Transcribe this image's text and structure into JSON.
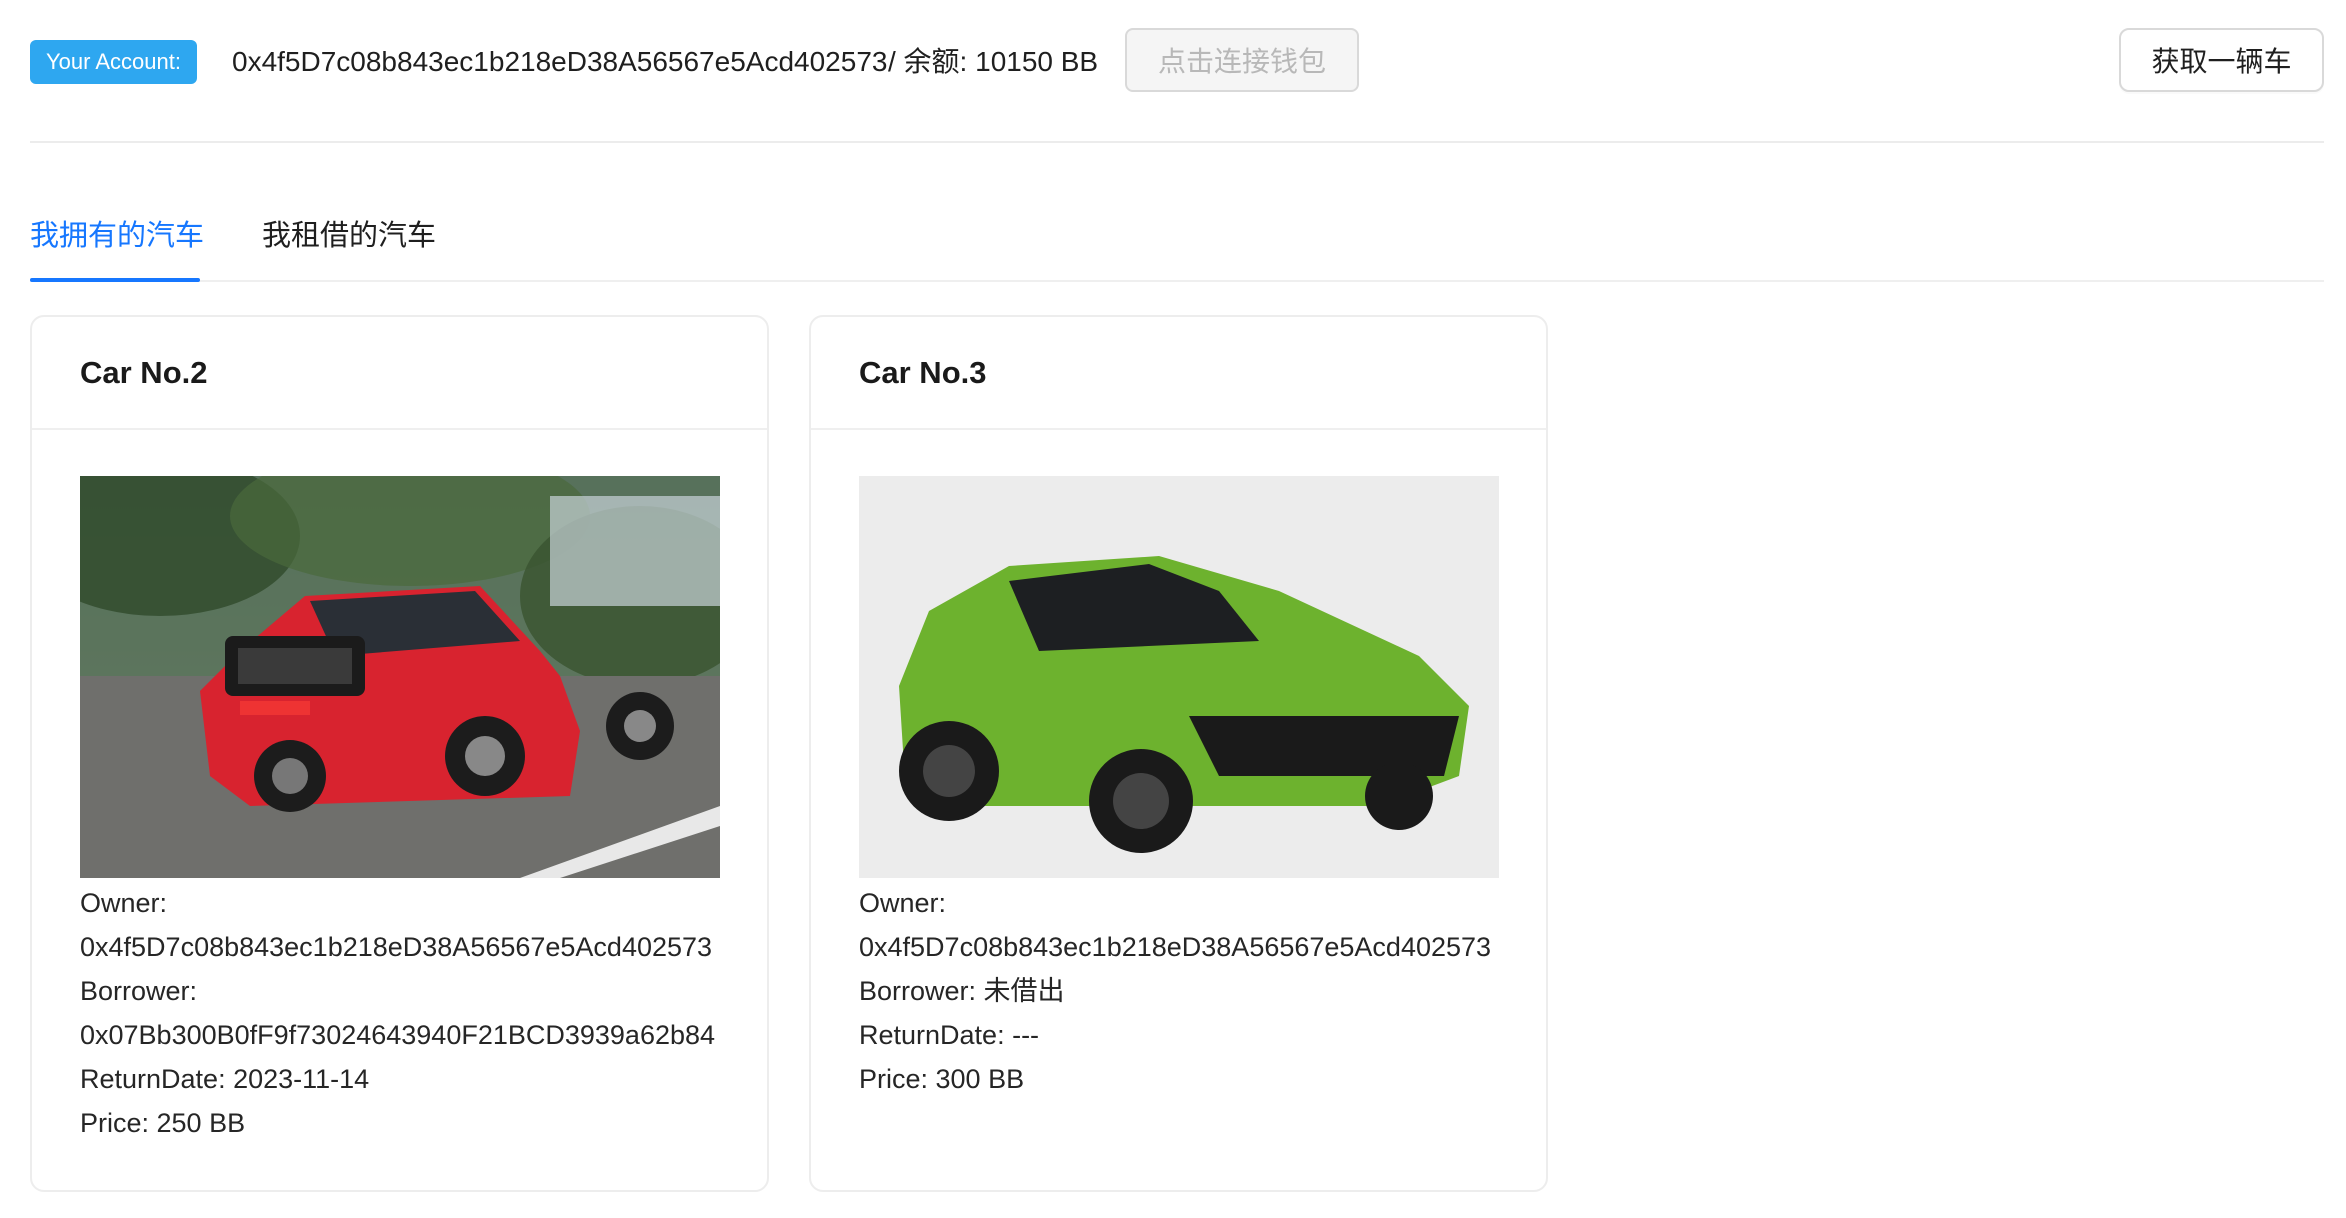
{
  "header": {
    "account_tag": "Your Account:",
    "account_address": "0x4f5D7c08b843ec1b218eD38A56567e5Acd402573",
    "balance_text": "/ 余额: 10150 BB",
    "connect_button": "点击连接钱包",
    "get_car_button": "获取一辆车"
  },
  "tabs": [
    {
      "label": "我拥有的汽车",
      "active": true
    },
    {
      "label": "我租借的汽车",
      "active": false
    }
  ],
  "cards": [
    {
      "title": "Car No.2",
      "owner_label": "Owner:",
      "owner": "0x4f5D7c08b843ec1b218eD38A56567e5Acd402573",
      "borrower_label": "Borrower:",
      "borrower": "0x07Bb300B0fF9f73024643940F21BCD3939a62b84",
      "return_date": "ReturnDate: 2023-11-14",
      "price": "Price: 250 BB",
      "car_color": "#d8232f"
    },
    {
      "title": "Car No.3",
      "owner_label": "Owner:",
      "owner": "0x4f5D7c08b843ec1b218eD38A56567e5Acd402573",
      "borrower_line": "Borrower: 未借出",
      "return_date": "ReturnDate: ---",
      "price": "Price: 300 BB",
      "car_color": "#6db22e"
    }
  ],
  "colors": {
    "accent": "#1677ff",
    "account_tag": "#2ea7f0"
  }
}
